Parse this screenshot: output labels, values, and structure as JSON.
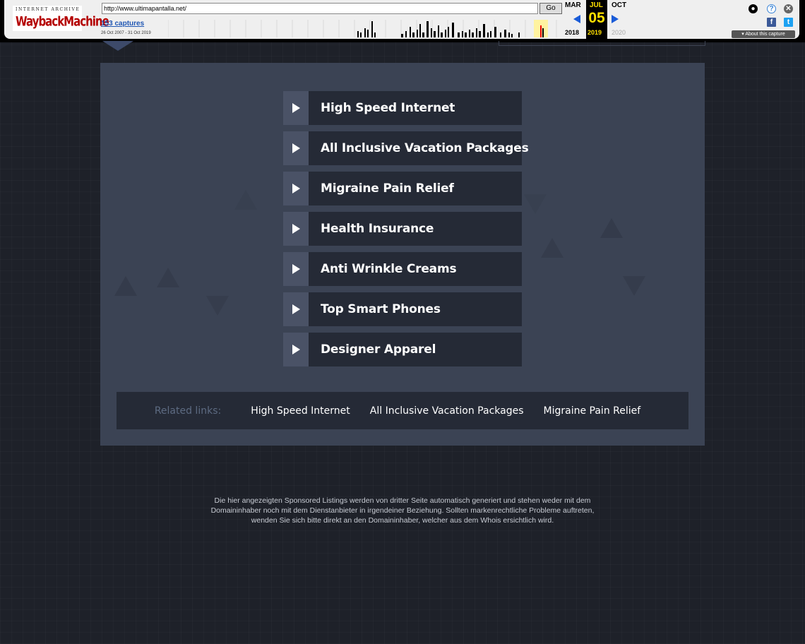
{
  "wayback": {
    "logo_top": "INTERNET ARCHIVE",
    "logo_main": "WaybackMachine",
    "url": "http://www.ultimapantalla.net/",
    "go_label": "Go",
    "captures": "153 captures",
    "range": "26 Oct 2007 - 31 Oct 2019",
    "prev_month": "MAR",
    "cur_month": "JUL",
    "next_month": "OCT",
    "cur_day": "05",
    "prev_year": "2018",
    "cur_year": "2019",
    "next_year": "2020",
    "about": "About this capture"
  },
  "links": [
    {
      "label": "High Speed Internet"
    },
    {
      "label": "All Inclusive Vacation Packages"
    },
    {
      "label": "Migraine Pain Relief"
    },
    {
      "label": "Health Insurance"
    },
    {
      "label": "Anti Wrinkle Creams"
    },
    {
      "label": "Top Smart Phones"
    },
    {
      "label": "Designer Apparel"
    }
  ],
  "related": {
    "title": "Related links:",
    "items": [
      "High Speed Internet",
      "All Inclusive Vacation Packages",
      "Migraine Pain Relief"
    ]
  },
  "disclaimer": "Die hier angezeigten Sponsored Listings werden von dritter Seite automatisch generiert und stehen weder mit dem Domaininhaber noch mit dem Dienstanbieter in irgendeiner Beziehung. Sollten markenrechtliche Probleme auftreten, wenden Sie sich bitte direkt an den Domaininhaber, welcher aus dem Whois ersichtlich wird.",
  "colors": {
    "background": "#1e2129",
    "panel": "#3b4354",
    "row": "#252a36",
    "play": "#4a5266",
    "related_title": "#5d6b82"
  }
}
